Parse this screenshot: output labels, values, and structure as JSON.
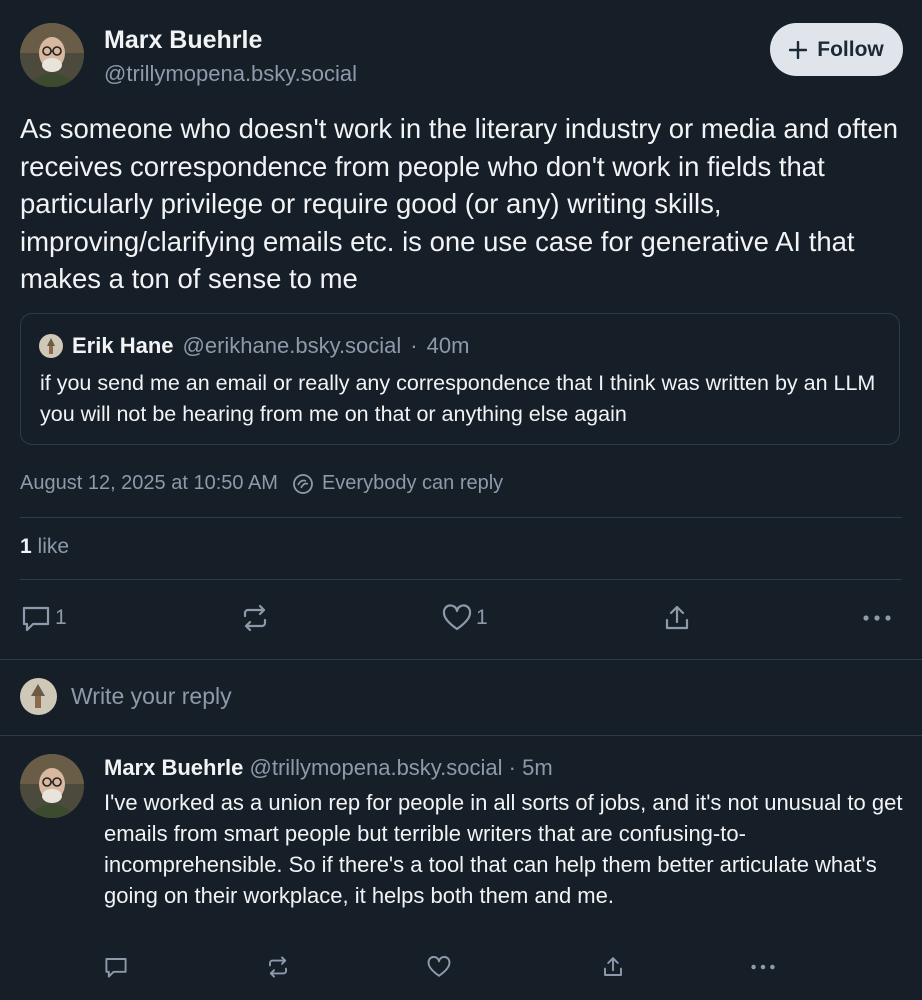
{
  "post": {
    "author_name": "Marx Buehrle",
    "author_handle": "@trillymopena.bsky.social",
    "follow_label": "Follow",
    "text": "As someone who doesn't work in the literary industry or media and often receives correspondence from people who don't work in fields that particularly privilege or require good (or any) writing skills, improving/clarifying emails etc. is one use case for generative AI that makes a ton of sense to me",
    "quote": {
      "author_name": "Erik Hane",
      "author_handle": "@erikhane.bsky.social",
      "separator": "·",
      "time": "40m",
      "text": "if you send me an email or really any correspondence that I think was written by an LLM you will not be hearing from me on that or anything else again"
    },
    "timestamp": "August 12, 2025 at 10:50 AM",
    "reply_setting": "Everybody can reply",
    "likes_count": "1",
    "likes_label": "like",
    "actions": {
      "reply_count": "1",
      "like_count": "1"
    }
  },
  "composer": {
    "placeholder": "Write your reply"
  },
  "reply": {
    "author_name": "Marx Buehrle",
    "author_handle": "@trillymopena.bsky.social",
    "separator": "·",
    "time": "5m",
    "text": "I've worked as a union rep for people in all sorts of jobs, and it's not unusual to get emails from smart people but terrible writers that are confusing-to-incomprehensible. So if there's a tool that can help them better articulate what's going on their workplace, it helps both them and me."
  },
  "colors": {
    "background": "#161e27",
    "text": "#f1f3f5",
    "muted": "#8d9aab",
    "divider": "#2e3b4a",
    "follow_bg": "#dfe5eb"
  }
}
